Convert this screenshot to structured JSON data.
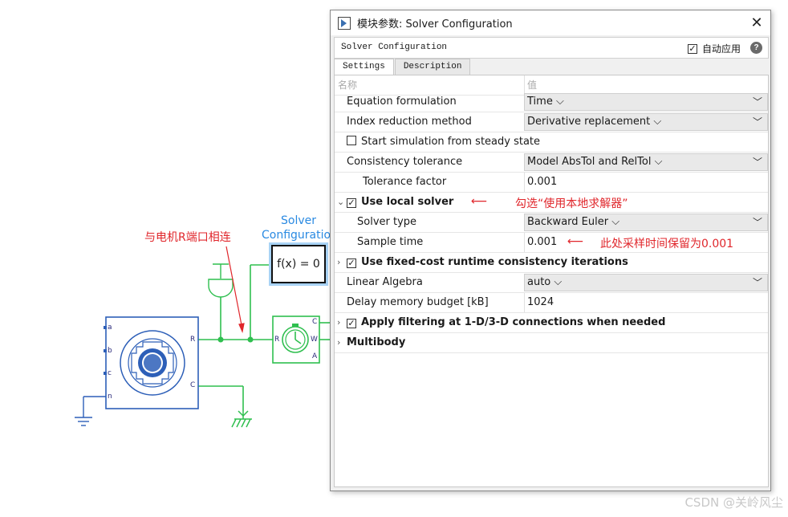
{
  "canvas": {
    "solver_block_title": "Solver\nConfiguration",
    "solver_block_expr": "f(x) = 0",
    "motor_annotation": "与电机R端口相连",
    "motor_ports": {
      "a": "a",
      "b": "b",
      "c": "c",
      "n": "n",
      "r": "R",
      "c_right": "C"
    },
    "sensor_ports": {
      "r": "R",
      "c": "C",
      "w": "W",
      "a": "A"
    },
    "watermark": "CSDN @关岭风尘"
  },
  "dialog": {
    "title": "模块参数: Solver Configuration",
    "block_name": "Solver Configuration",
    "auto_apply_label": "自动应用",
    "auto_apply_checked": true,
    "help_icon": "?",
    "close_icon": "✕",
    "tabs": [
      {
        "label": "Settings",
        "active": true
      },
      {
        "label": "Description",
        "active": false
      }
    ],
    "table_header": {
      "name": "名称",
      "value": "值"
    },
    "rows": {
      "equation_formulation": {
        "label": "Equation formulation",
        "value": "Time"
      },
      "index_reduction": {
        "label": "Index reduction method",
        "value": "Derivative replacement"
      },
      "steady_state": {
        "label": "Start simulation from steady state",
        "checked": false
      },
      "consistency_tolerance": {
        "label": "Consistency tolerance",
        "value": "Model AbsTol and RelTol"
      },
      "tolerance_factor": {
        "label": "Tolerance factor",
        "value": "0.001"
      },
      "use_local_solver": {
        "label": "Use local solver",
        "checked": true
      },
      "solver_type": {
        "label": "Solver type",
        "value": "Backward Euler"
      },
      "sample_time": {
        "label": "Sample time",
        "value": "0.001"
      },
      "fixed_cost": {
        "label": "Use fixed-cost runtime consistency iterations",
        "checked": true
      },
      "linear_algebra": {
        "label": "Linear Algebra",
        "value": "auto"
      },
      "delay_memory": {
        "label": "Delay memory budget [kB]",
        "value": "1024"
      },
      "apply_filtering": {
        "label": "Apply filtering at 1-D/3-D connections when needed",
        "checked": true
      },
      "multibody": {
        "label": "Multibody"
      }
    },
    "annotations": {
      "local_solver_note": "勾选“使用本地求解器”",
      "sample_time_note": "此处采样时间保留为0.001"
    }
  },
  "colors": {
    "wire": "#2fbf4f",
    "block_blue": "#2d5fb8",
    "annotation_red": "#e0262b",
    "selection_blue": "#a9d3f5"
  }
}
